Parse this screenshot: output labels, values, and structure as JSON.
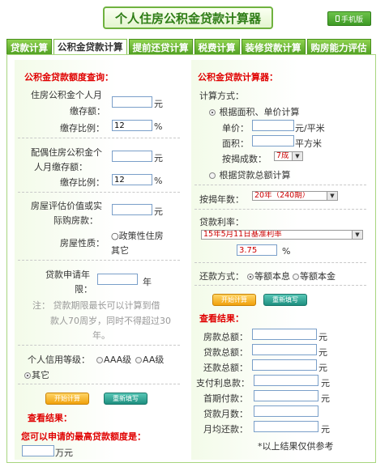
{
  "header": {
    "title": "个人住房公积金贷款计算器",
    "mobile_label": "手机版",
    "mobile_icon": "phone-icon"
  },
  "tabs": [
    "贷款计算",
    "公积金贷款计算",
    "提前还贷计算",
    "税费计算",
    "装修贷款计算",
    "购房能力评估"
  ],
  "left": {
    "heading": "公积金贷款额度查询：",
    "personal_salary_label1": "住房公积金个人月",
    "personal_salary_label2": "缴存额：",
    "unit_yuan": "元",
    "ratio_label": "缴存比例：",
    "ratio_value": "12",
    "pct": "%",
    "spouse_label1": "配偶住房公积金个",
    "spouse_label2": "人月缴存额：",
    "spouse_ratio_value": "12",
    "house_value_label1": "房屋评估价值或实",
    "house_value_label2": "际购房款：",
    "house_type_label": "房屋性质：",
    "house_type_opt1": "○政策性住房",
    "house_type_opt2": "其它",
    "years_label1": "贷款申请年",
    "years_label2": "限：",
    "unit_year": "年",
    "note1": "注： 贷款期限最长可以计算到借",
    "note2": "款人70周岁，同时不得超过30",
    "note3": "年。",
    "credit_label": "个人信用等级：",
    "credit_aaa": "AAA级",
    "credit_aa": "AA级",
    "credit_other": "其它",
    "calc_btn": "开始计算",
    "reset_btn": "重新填写",
    "results_heading": "查看结果：",
    "max_amount_label": "您可以申请的最高贷款额度是：",
    "unit_wan": "万元"
  },
  "right": {
    "heading": "公积金贷款计算器：",
    "method_label": "计算方式：",
    "method_opt1": "根据面积、单价计算",
    "price_label": "单价：",
    "price_unit": "元/平米",
    "area_label": "面积：",
    "area_unit": "平方米",
    "ratio_label": "按揭成数：",
    "ratio_value": "7成",
    "method_opt2": "根据贷款总额计算",
    "years_label": "按揭年数：",
    "years_value": "20年（240期）",
    "rate_label": "贷款利率：",
    "rate_select": "15年5月11日基准利率",
    "rate_value": "3.75",
    "pct": "%",
    "repay_label": "还款方式：",
    "repay_opt1": "等额本息",
    "repay_opt2": "等额本金",
    "calc_btn": "开始计算",
    "reset_btn": "重新填写",
    "results_heading": "查看结果：",
    "results": [
      {
        "label": "房款总额：",
        "unit": "元"
      },
      {
        "label": "贷款总额：",
        "unit": "元"
      },
      {
        "label": "还款总额：",
        "unit": "元"
      },
      {
        "label": "支付利息款：",
        "unit": "元"
      },
      {
        "label": "首期付款：",
        "unit": "元"
      },
      {
        "label": "贷款月数：",
        "unit": ""
      },
      {
        "label": "月均还款：",
        "unit": "元"
      }
    ],
    "footnote": "*以上结果仅供参考"
  }
}
